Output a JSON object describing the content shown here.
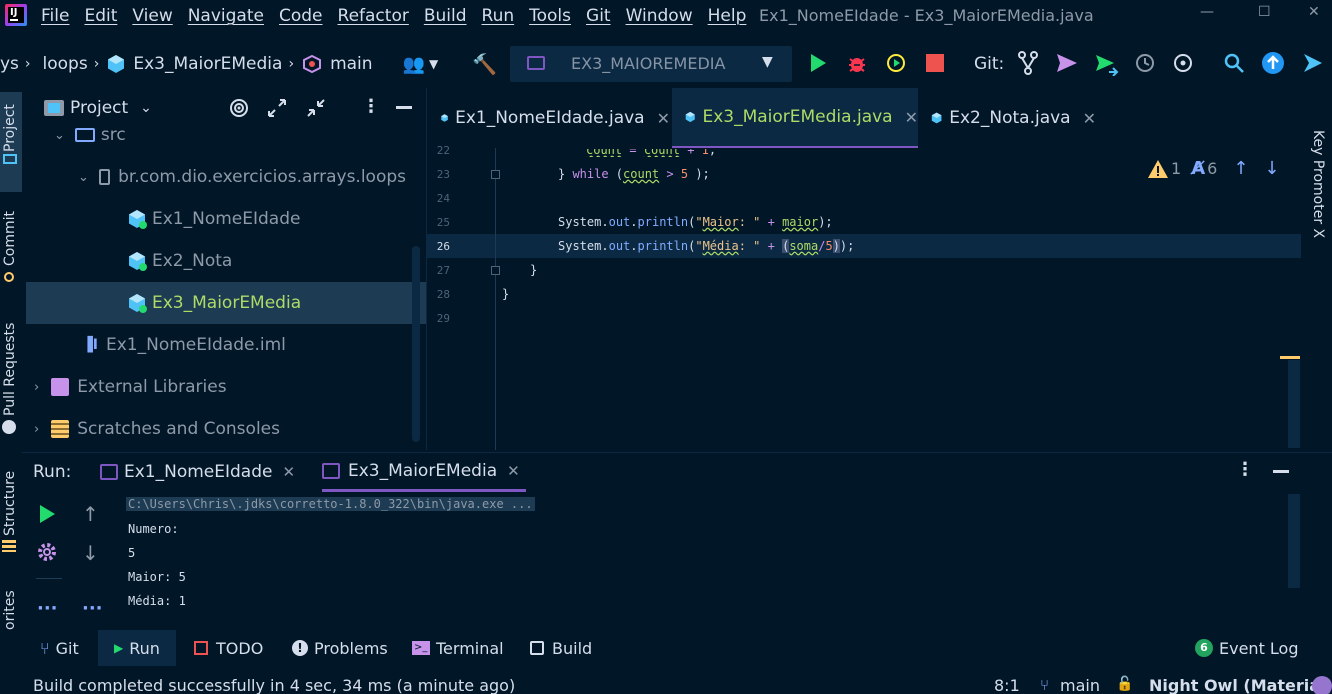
{
  "window": {
    "title": "Ex1_NomeEIdade - Ex3_MaiorEMedia.java",
    "app_logo": "IJ"
  },
  "menu": [
    "File",
    "Edit",
    "View",
    "Navigate",
    "Code",
    "Refactor",
    "Build",
    "Run",
    "Tools",
    "Git",
    "Window",
    "Help"
  ],
  "breadcrumb": {
    "prefix": "ys",
    "package": "loops",
    "class": "Ex3_MaiorEMedia",
    "method": "main"
  },
  "toolbar": {
    "run_config": "EX3_MAIOREMEDIA",
    "git_label": "Git:"
  },
  "left_stripe": {
    "project": "Project",
    "commit": "Commit",
    "pull_requests": "Pull Requests",
    "structure": "Structure",
    "favorites": "orites"
  },
  "right_stripe": {
    "key_promoter": "Key Promoter X"
  },
  "project_panel": {
    "title": "Project",
    "tree": [
      {
        "label": "src",
        "type": "folder-src"
      },
      {
        "label": "br.com.dio.exercicios.arrays.loops",
        "type": "package"
      },
      {
        "label": "Ex1_NomeEIdade",
        "type": "class"
      },
      {
        "label": "Ex2_Nota",
        "type": "class"
      },
      {
        "label": "Ex3_MaiorEMedia",
        "type": "class",
        "selected": true
      },
      {
        "label": "Ex1_NomeEIdade.iml",
        "type": "iml"
      },
      {
        "label": "External Libraries",
        "type": "library"
      },
      {
        "label": "Scratches and Consoles",
        "type": "scratches"
      }
    ]
  },
  "editor": {
    "tabs": [
      {
        "label": "Ex1_NomeEIdade.java",
        "active": false
      },
      {
        "label": "Ex3_MaiorEMedia.java",
        "active": true
      },
      {
        "label": "Ex2_Nota.java",
        "active": false
      }
    ],
    "inspections": {
      "warnings": "1",
      "typos": "6"
    },
    "line_numbers": [
      "22",
      "23",
      "24",
      "25",
      "26",
      "27",
      "28",
      "29"
    ],
    "current_line": "26"
  },
  "run_panel": {
    "label": "Run:",
    "tabs": [
      {
        "label": "Ex1_NomeEIdade",
        "active": false
      },
      {
        "label": "Ex3_MaiorEMedia",
        "active": true
      }
    ],
    "console": [
      "C:\\Users\\Chris\\.jdks\\corretto-1.8.0_322\\bin\\java.exe ...",
      "Numero:",
      "5",
      "Maior: 5",
      "Média: 1"
    ]
  },
  "bottom_tools": [
    {
      "label": "Git",
      "icon": "git-branch-icon"
    },
    {
      "label": "Run",
      "icon": "run-icon",
      "active": true
    },
    {
      "label": "TODO",
      "icon": "todo-icon"
    },
    {
      "label": "Problems",
      "icon": "problems-icon"
    },
    {
      "label": "Terminal",
      "icon": "terminal-icon"
    },
    {
      "label": "Build",
      "icon": "build-icon"
    }
  ],
  "event_log": {
    "count": "6",
    "label": "Event Log"
  },
  "status": {
    "message": "Build completed successfully in 4 sec, 34 ms (a minute ago)",
    "position": "8:1",
    "branch": "main",
    "theme": "Night Owl (Material)"
  },
  "colors": {
    "background": "#011627",
    "selection": "#1d3b53",
    "accent": "#7e57c2",
    "keyword": "#c792ea",
    "string": "#ecc48d",
    "number": "#f78c6c",
    "variable": "#addb67",
    "function": "#82aaff",
    "run_green": "#22da6e",
    "stop_red": "#ef5350",
    "debug_red": "#f9364f"
  }
}
